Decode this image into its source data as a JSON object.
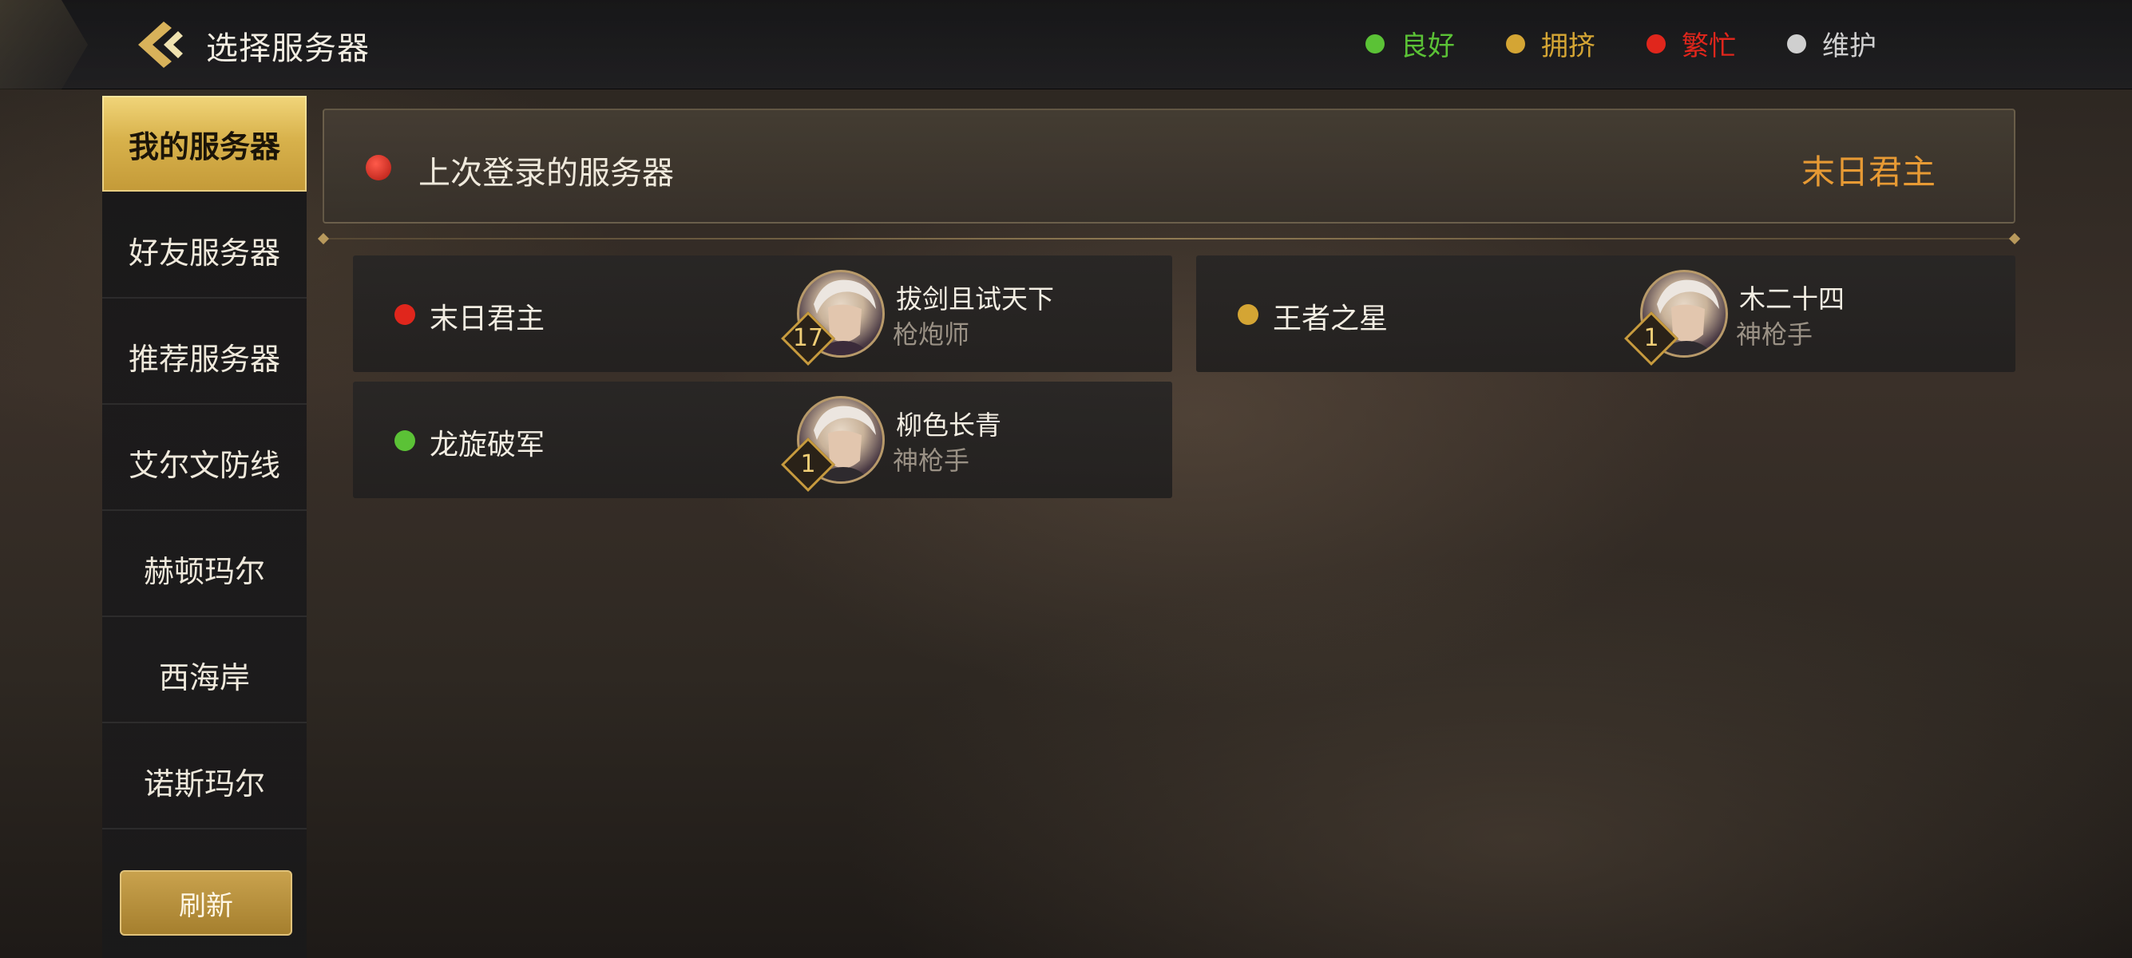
{
  "header": {
    "title": "选择服务器",
    "legend": [
      {
        "label": "良好",
        "color": "#5bc236"
      },
      {
        "label": "拥挤",
        "color": "#d4a534"
      },
      {
        "label": "繁忙",
        "color": "#e0261c"
      },
      {
        "label": "维护",
        "color": "#cfcfcf"
      }
    ]
  },
  "sidebar": {
    "tabs": [
      {
        "label": "我的服务器",
        "active": true
      },
      {
        "label": "好友服务器"
      },
      {
        "label": "推荐服务器"
      },
      {
        "label": "艾尔文防线"
      },
      {
        "label": "赫顿玛尔"
      },
      {
        "label": "西海岸"
      },
      {
        "label": "诺斯玛尔"
      }
    ],
    "refresh_label": "刷新"
  },
  "last_login": {
    "label": "上次登录的服务器",
    "server": "末日君主",
    "status_color": "#d0281d"
  },
  "servers": [
    {
      "name": "末日君主",
      "status_color": "#e0261c",
      "level": "17",
      "character": "拔剑且试天下",
      "class": "枪炮师"
    },
    {
      "name": "王者之星",
      "status_color": "#d4a534",
      "level": "1",
      "character": "木二十四",
      "class": "神枪手"
    },
    {
      "name": "龙旋破军",
      "status_color": "#5bc236",
      "level": "1",
      "character": "柳色长青",
      "class": "神枪手"
    }
  ]
}
